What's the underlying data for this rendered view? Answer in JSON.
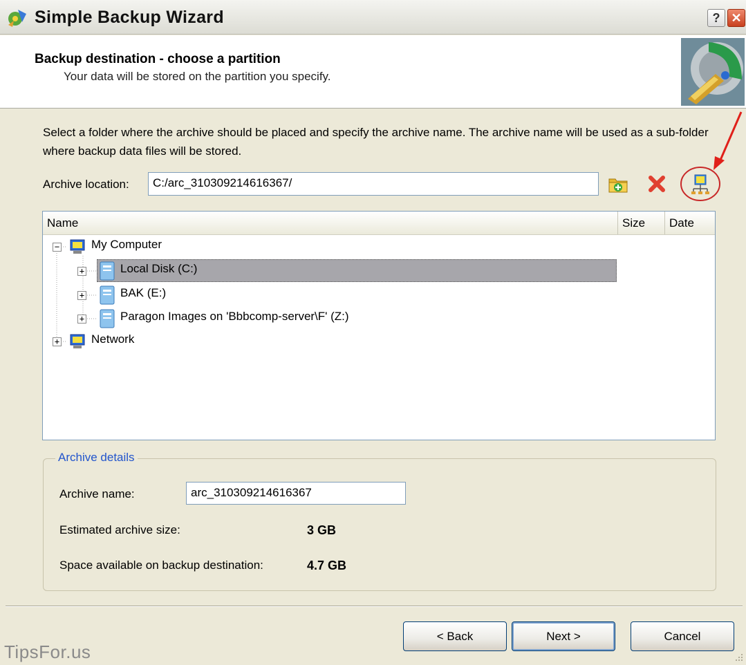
{
  "window": {
    "title": "Simple Backup Wizard",
    "help_label": "?",
    "close_label": "✕"
  },
  "header": {
    "title": "Backup destination - choose a partition",
    "subtitle": "Your data will be stored on the partition you specify."
  },
  "description": "Select a folder where the archive should be placed and specify the archive name. The archive name will be used as a sub-folder where backup data files will be stored.",
  "location": {
    "label": "Archive location:",
    "value": "C:/arc_310309214616367/"
  },
  "toolbar_icons": [
    "folder-add-icon",
    "delete-icon",
    "network-drive-icon"
  ],
  "tree": {
    "columns": [
      "Name",
      "Size",
      "Date"
    ],
    "items": [
      {
        "label": "My Computer",
        "icon": "computer-icon",
        "expanded": true
      },
      {
        "label": "Local Disk (C:)",
        "icon": "disk-icon",
        "selected": true
      },
      {
        "label": "BAK (E:)",
        "icon": "disk-icon"
      },
      {
        "label": "Paragon Images on 'Bbbcomp-server\\F' (Z:)",
        "icon": "disk-icon"
      },
      {
        "label": "Network",
        "icon": "network-icon",
        "expanded": false
      }
    ]
  },
  "details": {
    "legend": "Archive details",
    "name_label": "Archive name:",
    "name_value": "arc_310309214616367",
    "est_label": "Estimated archive size:",
    "est_value": "3 GB",
    "space_label": "Space available on backup destination:",
    "space_value": "4.7 GB"
  },
  "buttons": {
    "back": "< Back",
    "next": "Next >",
    "cancel": "Cancel"
  },
  "watermark": "TipsFor.us",
  "colors": {
    "dialog_bg": "#ece9d8",
    "accent_blue": "#2255cc",
    "annotation_red": "#e0201a",
    "selection": "#a7a6ab"
  }
}
